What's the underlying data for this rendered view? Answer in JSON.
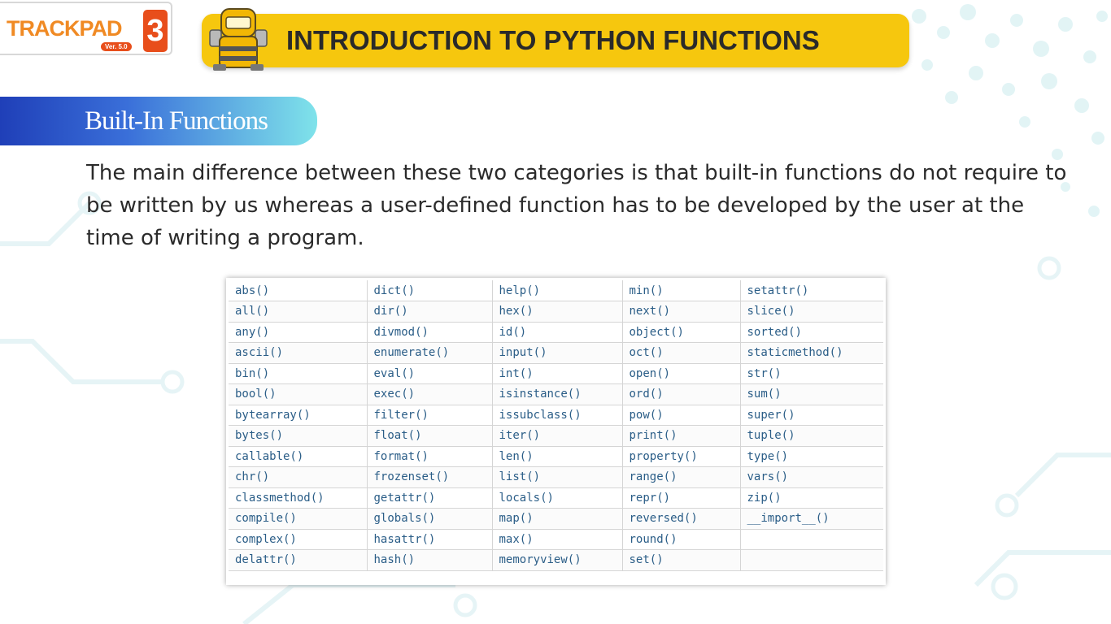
{
  "logo": {
    "word": "TRACKPAD",
    "number": "3",
    "version": "Ver. 5.0"
  },
  "header": {
    "title": "INTRODUCTION TO PYTHON FUNCTIONS"
  },
  "section": {
    "title": "Built-In Functions"
  },
  "paragraph": "The main difference between these two categories is that built-in functions do not require to be written by us whereas a user-defined function has to be developed by the user at the time of writing a program.",
  "colors": {
    "accent_yellow": "#f6c70e",
    "banner_blue": "#1f3fb8",
    "banner_cyan": "#7fe3ea",
    "code_blue": "#2a5d87",
    "logo_orange": "#e84e1b"
  },
  "table": {
    "rows": [
      [
        "abs()",
        "dict()",
        "help()",
        "min()",
        "setattr()"
      ],
      [
        "all()",
        "dir()",
        "hex()",
        "next()",
        "slice()"
      ],
      [
        "any()",
        "divmod()",
        "id()",
        "object()",
        "sorted()"
      ],
      [
        "ascii()",
        "enumerate()",
        "input()",
        "oct()",
        "staticmethod()"
      ],
      [
        "bin()",
        "eval()",
        "int()",
        "open()",
        "str()"
      ],
      [
        "bool()",
        "exec()",
        "isinstance()",
        "ord()",
        "sum()"
      ],
      [
        "bytearray()",
        "filter()",
        "issubclass()",
        "pow()",
        "super()"
      ],
      [
        "bytes()",
        "float()",
        "iter()",
        "print()",
        "tuple()"
      ],
      [
        "callable()",
        "format()",
        "len()",
        "property()",
        "type()"
      ],
      [
        "chr()",
        "frozenset()",
        "list()",
        "range()",
        "vars()"
      ],
      [
        "classmethod()",
        "getattr()",
        "locals()",
        "repr()",
        "zip()"
      ],
      [
        "compile()",
        "globals()",
        "map()",
        "reversed()",
        "__import__()"
      ],
      [
        "complex()",
        "hasattr()",
        "max()",
        "round()",
        ""
      ],
      [
        "delattr()",
        "hash()",
        "memoryview()",
        "set()",
        ""
      ]
    ]
  }
}
